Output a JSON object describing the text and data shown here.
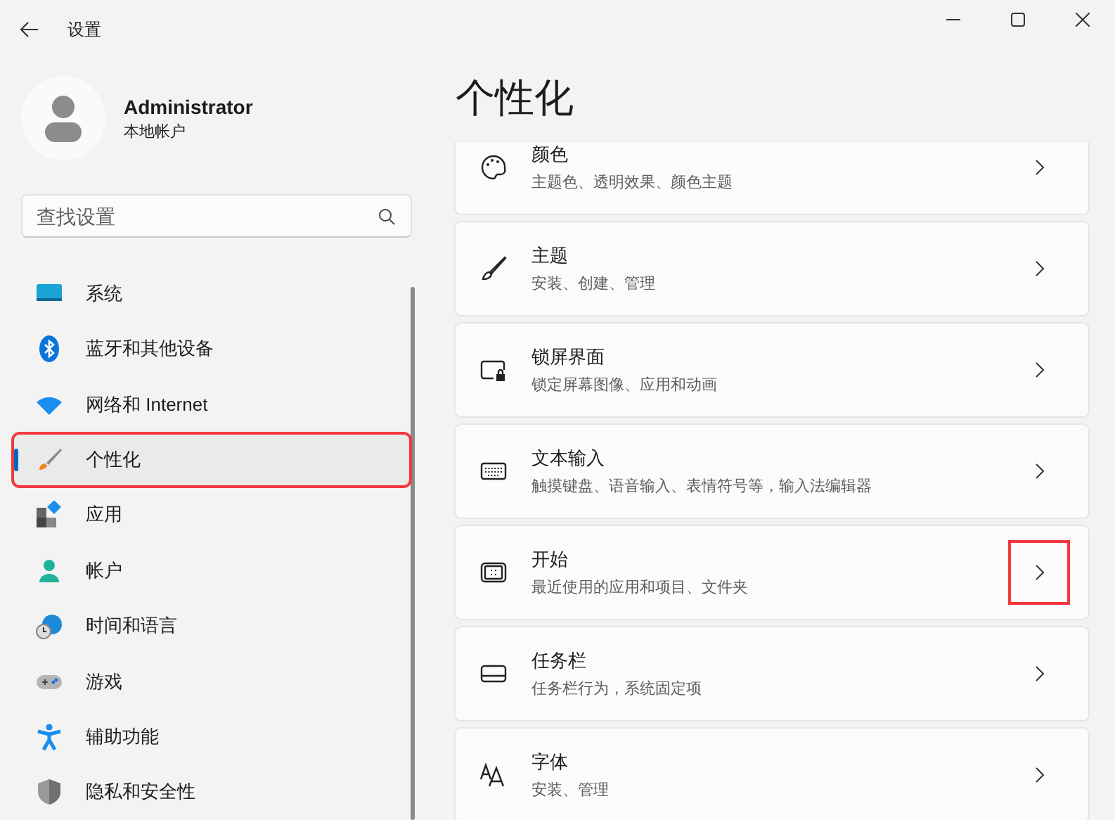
{
  "window": {
    "title": "设置"
  },
  "account": {
    "name": "Administrator",
    "type": "本地帐户"
  },
  "search": {
    "placeholder": "查找设置"
  },
  "nav": [
    {
      "label": "系统",
      "selected": false,
      "highlighted": false
    },
    {
      "label": "蓝牙和其他设备",
      "selected": false,
      "highlighted": false
    },
    {
      "label": "网络和 Internet",
      "selected": false,
      "highlighted": false
    },
    {
      "label": "个性化",
      "selected": true,
      "highlighted": true
    },
    {
      "label": "应用",
      "selected": false,
      "highlighted": false
    },
    {
      "label": "帐户",
      "selected": false,
      "highlighted": false
    },
    {
      "label": "时间和语言",
      "selected": false,
      "highlighted": false
    },
    {
      "label": "游戏",
      "selected": false,
      "highlighted": false
    },
    {
      "label": "辅助功能",
      "selected": false,
      "highlighted": false
    },
    {
      "label": "隐私和安全性",
      "selected": false,
      "highlighted": false
    }
  ],
  "page": {
    "title": "个性化"
  },
  "cards": [
    {
      "title": "颜色",
      "subtitle": "主题色、透明效果、颜色主题",
      "highlighted": false
    },
    {
      "title": "主题",
      "subtitle": "安装、创建、管理",
      "highlighted": false
    },
    {
      "title": "锁屏界面",
      "subtitle": "锁定屏幕图像、应用和动画",
      "highlighted": false
    },
    {
      "title": "文本输入",
      "subtitle": "触摸键盘、语音输入、表情符号等，输入法编辑器",
      "highlighted": false
    },
    {
      "title": "开始",
      "subtitle": "最近使用的应用和项目、文件夹",
      "highlighted": true
    },
    {
      "title": "任务栏",
      "subtitle": "任务栏行为，系统固定项",
      "highlighted": false
    },
    {
      "title": "字体",
      "subtitle": "安装、管理",
      "highlighted": false
    }
  ]
}
